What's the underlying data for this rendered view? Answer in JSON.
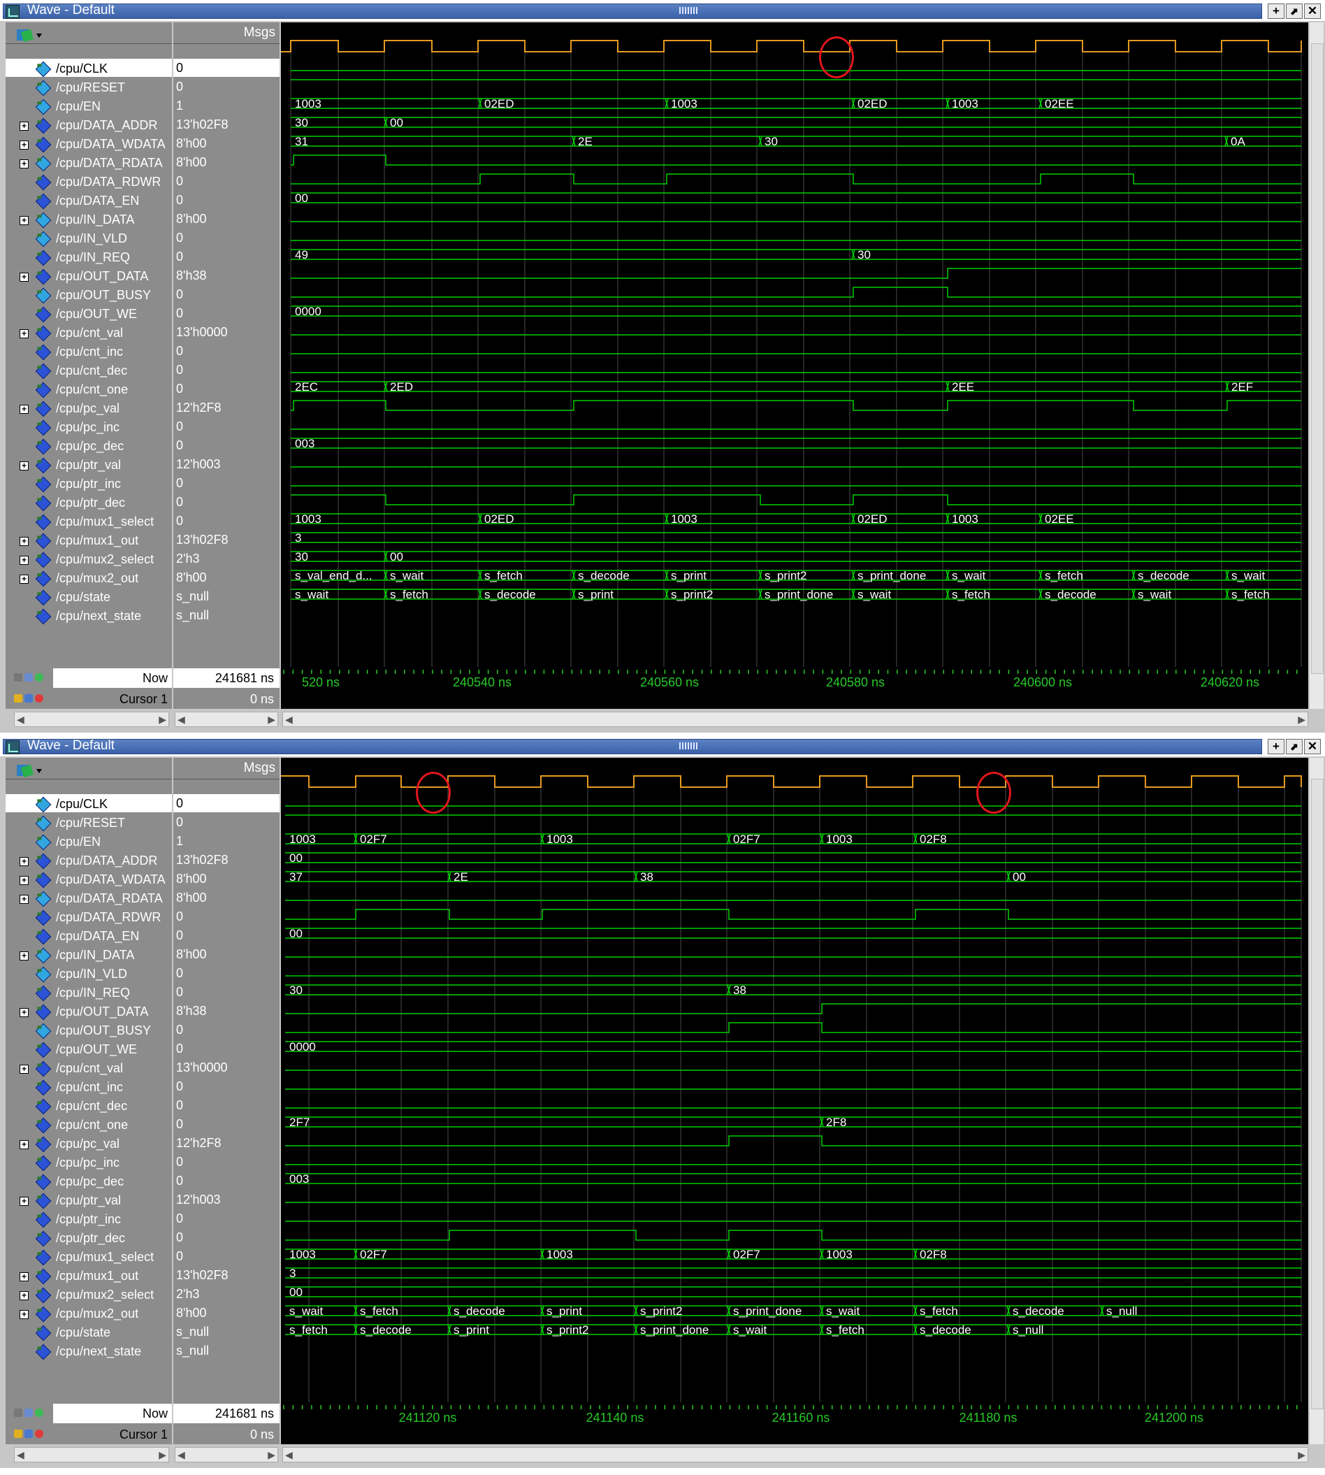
{
  "colors": {
    "titlebar": "#3a60a8",
    "signal": "#00d000",
    "clock": "#e69a1f",
    "grid": "#4a4a4a",
    "timeline_text": "#28c828",
    "highlight_circle": "#e0161c"
  },
  "windows": [
    {
      "title": "Wave - Default",
      "msgs_header": "Msgs",
      "now_label": "Now",
      "now_value": "241681 ns",
      "cursor_label": "Cursor 1",
      "cursor_value": "0 ns",
      "timeline_labels": [
        "520 ns",
        "240540 ns",
        "240560 ns",
        "240580 ns",
        "240600 ns",
        "240620 ns"
      ],
      "signals": [
        {
          "name": "/cpu/CLK",
          "value": "0",
          "expand": false,
          "dir": "in",
          "selected": true
        },
        {
          "name": "/cpu/RESET",
          "value": "0",
          "expand": false,
          "dir": "in"
        },
        {
          "name": "/cpu/EN",
          "value": "1",
          "expand": false,
          "dir": "in"
        },
        {
          "name": "/cpu/DATA_ADDR",
          "value": "13'h02F8",
          "expand": true,
          "dir": "out"
        },
        {
          "name": "/cpu/DATA_WDATA",
          "value": "8'h00",
          "expand": true,
          "dir": "out"
        },
        {
          "name": "/cpu/DATA_RDATA",
          "value": "8'h00",
          "expand": true,
          "dir": "in"
        },
        {
          "name": "/cpu/DATA_RDWR",
          "value": "0",
          "expand": false,
          "dir": "out"
        },
        {
          "name": "/cpu/DATA_EN",
          "value": "0",
          "expand": false,
          "dir": "out"
        },
        {
          "name": "/cpu/IN_DATA",
          "value": "8'h00",
          "expand": true,
          "dir": "in"
        },
        {
          "name": "/cpu/IN_VLD",
          "value": "0",
          "expand": false,
          "dir": "in"
        },
        {
          "name": "/cpu/IN_REQ",
          "value": "0",
          "expand": false,
          "dir": "out"
        },
        {
          "name": "/cpu/OUT_DATA",
          "value": "8'h38",
          "expand": true,
          "dir": "out"
        },
        {
          "name": "/cpu/OUT_BUSY",
          "value": "0",
          "expand": false,
          "dir": "in"
        },
        {
          "name": "/cpu/OUT_WE",
          "value": "0",
          "expand": false,
          "dir": "out"
        },
        {
          "name": "/cpu/cnt_val",
          "value": "13'h0000",
          "expand": true,
          "dir": "int"
        },
        {
          "name": "/cpu/cnt_inc",
          "value": "0",
          "expand": false,
          "dir": "int"
        },
        {
          "name": "/cpu/cnt_dec",
          "value": "0",
          "expand": false,
          "dir": "int"
        },
        {
          "name": "/cpu/cnt_one",
          "value": "0",
          "expand": false,
          "dir": "int"
        },
        {
          "name": "/cpu/pc_val",
          "value": "12'h2F8",
          "expand": true,
          "dir": "int"
        },
        {
          "name": "/cpu/pc_inc",
          "value": "0",
          "expand": false,
          "dir": "int"
        },
        {
          "name": "/cpu/pc_dec",
          "value": "0",
          "expand": false,
          "dir": "int"
        },
        {
          "name": "/cpu/ptr_val",
          "value": "12'h003",
          "expand": true,
          "dir": "int"
        },
        {
          "name": "/cpu/ptr_inc",
          "value": "0",
          "expand": false,
          "dir": "int"
        },
        {
          "name": "/cpu/ptr_dec",
          "value": "0",
          "expand": false,
          "dir": "int"
        },
        {
          "name": "/cpu/mux1_select",
          "value": "0",
          "expand": false,
          "dir": "int"
        },
        {
          "name": "/cpu/mux1_out",
          "value": "13'h02F8",
          "expand": true,
          "dir": "int"
        },
        {
          "name": "/cpu/mux2_select",
          "value": "2'h3",
          "expand": true,
          "dir": "int"
        },
        {
          "name": "/cpu/mux2_out",
          "value": "8'h00",
          "expand": true,
          "dir": "int"
        },
        {
          "name": "/cpu/state",
          "value": "s_null",
          "expand": false,
          "dir": "int"
        },
        {
          "name": "/cpu/next_state",
          "value": "s_null",
          "expand": false,
          "dir": "int"
        }
      ],
      "bus_labels": {
        "DATA_ADDR": [
          "1003",
          "02ED",
          "1003",
          "02ED",
          "1003",
          "02EE"
        ],
        "DATA_WDATA": [
          "30",
          "00"
        ],
        "DATA_RDATA": [
          "31",
          "2E",
          "30",
          "0A"
        ],
        "IN_DATA": [
          "00"
        ],
        "OUT_DATA": [
          "49",
          "30"
        ],
        "cnt_val": [
          "0000"
        ],
        "pc_val": [
          "2EC",
          "2ED",
          "2EE",
          "2EF"
        ],
        "ptr_val": [
          "003"
        ],
        "mux1_out": [
          "1003",
          "02ED",
          "1003",
          "02ED",
          "1003",
          "02EE"
        ],
        "mux2_select": [
          "3"
        ],
        "mux2_out": [
          "30",
          "00"
        ],
        "state": [
          "s_val_end_d...",
          "s_wait",
          "s_fetch",
          "s_decode",
          "s_print",
          "s_print2",
          "s_print_done",
          "s_wait",
          "s_fetch",
          "s_decode",
          "s_wait"
        ],
        "next_state": [
          "s_wait",
          "s_fetch",
          "s_decode",
          "s_print",
          "s_print2",
          "s_print_done",
          "s_wait",
          "s_fetch",
          "s_decode",
          "s_wait",
          "s_fetch"
        ]
      }
    },
    {
      "title": "Wave - Default",
      "msgs_header": "Msgs",
      "now_label": "Now",
      "now_value": "241681 ns",
      "cursor_label": "Cursor 1",
      "cursor_value": "0 ns",
      "timeline_labels": [
        "241120 ns",
        "241140 ns",
        "241160 ns",
        "241180 ns",
        "241200 ns"
      ],
      "signals": [
        {
          "name": "/cpu/CLK",
          "value": "0",
          "expand": false,
          "dir": "in",
          "selected": true
        },
        {
          "name": "/cpu/RESET",
          "value": "0",
          "expand": false,
          "dir": "in"
        },
        {
          "name": "/cpu/EN",
          "value": "1",
          "expand": false,
          "dir": "in"
        },
        {
          "name": "/cpu/DATA_ADDR",
          "value": "13'h02F8",
          "expand": true,
          "dir": "out"
        },
        {
          "name": "/cpu/DATA_WDATA",
          "value": "8'h00",
          "expand": true,
          "dir": "out"
        },
        {
          "name": "/cpu/DATA_RDATA",
          "value": "8'h00",
          "expand": true,
          "dir": "in"
        },
        {
          "name": "/cpu/DATA_RDWR",
          "value": "0",
          "expand": false,
          "dir": "out"
        },
        {
          "name": "/cpu/DATA_EN",
          "value": "0",
          "expand": false,
          "dir": "out"
        },
        {
          "name": "/cpu/IN_DATA",
          "value": "8'h00",
          "expand": true,
          "dir": "in"
        },
        {
          "name": "/cpu/IN_VLD",
          "value": "0",
          "expand": false,
          "dir": "in"
        },
        {
          "name": "/cpu/IN_REQ",
          "value": "0",
          "expand": false,
          "dir": "out"
        },
        {
          "name": "/cpu/OUT_DATA",
          "value": "8'h38",
          "expand": true,
          "dir": "out"
        },
        {
          "name": "/cpu/OUT_BUSY",
          "value": "0",
          "expand": false,
          "dir": "in"
        },
        {
          "name": "/cpu/OUT_WE",
          "value": "0",
          "expand": false,
          "dir": "out"
        },
        {
          "name": "/cpu/cnt_val",
          "value": "13'h0000",
          "expand": true,
          "dir": "int"
        },
        {
          "name": "/cpu/cnt_inc",
          "value": "0",
          "expand": false,
          "dir": "int"
        },
        {
          "name": "/cpu/cnt_dec",
          "value": "0",
          "expand": false,
          "dir": "int"
        },
        {
          "name": "/cpu/cnt_one",
          "value": "0",
          "expand": false,
          "dir": "int"
        },
        {
          "name": "/cpu/pc_val",
          "value": "12'h2F8",
          "expand": true,
          "dir": "int"
        },
        {
          "name": "/cpu/pc_inc",
          "value": "0",
          "expand": false,
          "dir": "int"
        },
        {
          "name": "/cpu/pc_dec",
          "value": "0",
          "expand": false,
          "dir": "int"
        },
        {
          "name": "/cpu/ptr_val",
          "value": "12'h003",
          "expand": true,
          "dir": "int"
        },
        {
          "name": "/cpu/ptr_inc",
          "value": "0",
          "expand": false,
          "dir": "int"
        },
        {
          "name": "/cpu/ptr_dec",
          "value": "0",
          "expand": false,
          "dir": "int"
        },
        {
          "name": "/cpu/mux1_select",
          "value": "0",
          "expand": false,
          "dir": "int"
        },
        {
          "name": "/cpu/mux1_out",
          "value": "13'h02F8",
          "expand": true,
          "dir": "int"
        },
        {
          "name": "/cpu/mux2_select",
          "value": "2'h3",
          "expand": true,
          "dir": "int"
        },
        {
          "name": "/cpu/mux2_out",
          "value": "8'h00",
          "expand": true,
          "dir": "int"
        },
        {
          "name": "/cpu/state",
          "value": "s_null",
          "expand": false,
          "dir": "int"
        },
        {
          "name": "/cpu/next_state",
          "value": "s_null",
          "expand": false,
          "dir": "int"
        }
      ],
      "bus_labels": {
        "DATA_ADDR": [
          "1003",
          "02F7",
          "1003",
          "02F7",
          "1003",
          "02F8"
        ],
        "DATA_WDATA": [
          "00"
        ],
        "DATA_RDATA": [
          "37",
          "2E",
          "38",
          "00"
        ],
        "IN_DATA": [
          "00"
        ],
        "OUT_DATA": [
          "30",
          "38"
        ],
        "cnt_val": [
          "0000"
        ],
        "pc_val": [
          "2F7",
          "2F8"
        ],
        "ptr_val": [
          "003"
        ],
        "mux1_out": [
          "1003",
          "02F7",
          "1003",
          "02F7",
          "1003",
          "02F8"
        ],
        "mux2_select": [
          "3"
        ],
        "mux2_out": [
          "00"
        ],
        "state": [
          "s_wait",
          "s_fetch",
          "s_decode",
          "s_print",
          "s_print2",
          "s_print_done",
          "s_wait",
          "s_fetch",
          "s_decode",
          "s_null"
        ],
        "next_state": [
          "s_fetch",
          "s_decode",
          "s_print",
          "s_print2",
          "s_print_done",
          "s_wait",
          "s_fetch",
          "s_decode",
          "s_null"
        ]
      }
    }
  ]
}
